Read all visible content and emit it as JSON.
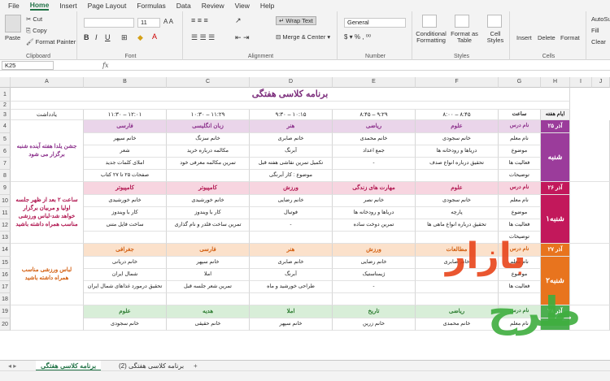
{
  "menu": [
    "File",
    "Home",
    "Insert",
    "Page Layout",
    "Formulas",
    "Data",
    "Review",
    "View",
    "Help"
  ],
  "ribbon": {
    "clipboard": {
      "paste": "Paste",
      "cut": "Cut",
      "copy": "Copy",
      "painter": "Format Painter",
      "label": "Clipboard"
    },
    "font": {
      "name": "",
      "size": "11",
      "label": "Font"
    },
    "alignment": {
      "wrap": "Wrap Text",
      "merge": "Merge & Center",
      "label": "Alignment"
    },
    "number": {
      "format": "General",
      "label": "Number"
    },
    "styles": {
      "cond": "Conditional Formatting",
      "table": "Format as Table",
      "cell": "Cell Styles",
      "label": "Styles"
    },
    "cells": {
      "insert": "Insert",
      "delete": "Delete",
      "format": "Format",
      "label": "Cells"
    },
    "editing": {
      "autosum": "AutoSu",
      "fill": "Fill",
      "clear": "Clear"
    }
  },
  "formula_bar": {
    "name_box": "K25",
    "fx": "fx",
    "value": ""
  },
  "columns": [
    "A",
    "B",
    "C",
    "D",
    "E",
    "F",
    "G",
    "H",
    "I",
    "J"
  ],
  "rows": [
    "1",
    "2",
    "3",
    "4",
    "5",
    "6",
    "7",
    "8",
    "9",
    "10",
    "11",
    "12",
    "13",
    "14",
    "15",
    "16",
    "17",
    "18",
    "19",
    "20"
  ],
  "sheet": {
    "title": "برنامه کلاسی هفتگی",
    "header": {
      "week": "ایام هفته",
      "time": "ساعت",
      "slots": [
        "۸:۰۰ – ۸:۴۵",
        "۸:۴۵ – ۹:۲۹",
        "۹:۳۰ – ۱۰:۱۵",
        "۱۰:۳۰ – ۱۱:۲۹",
        "۱۱:۳۰ – ۱۲:۰۱"
      ],
      "notes": "یادداشت"
    },
    "days": [
      {
        "name": "شنبه",
        "date": "۲۵ آذر",
        "color": "#9b3c9b",
        "light": "#ead5ea",
        "text": "#8b2f8b",
        "subjects": [
          "علوم",
          "ریاضی",
          "هنر",
          "زبان انگلیسی",
          "فارسی"
        ],
        "teachers": [
          "خانم سجودی",
          "خانم محمدی",
          "خانم صابری",
          "خانم سزنگ",
          "خانم سپهر"
        ],
        "topics": [
          "دریاها و رودخانه ها",
          "جمع اعداد",
          "آبرنگ",
          "مکالمه درباره خرید",
          "شعر"
        ],
        "activities": [
          "تحقیق درباره انواع صدف",
          "-",
          "تکمیل تمرین نقاشی هفته قبل",
          "تمرین مکالمه معرفی خود",
          "املای کلمات جدید"
        ],
        "desc": [
          "",
          "",
          "موضوع : کار آبرنگی",
          "",
          "صفحات ۲۵ تا ۲۷ کتاب"
        ],
        "note": "جشن یلدا هفته آینده شنبه برگزار می شود",
        "rows": [
          "نام درس",
          "نام معلم",
          "موضوع",
          "فعالیت ها",
          "توضیحات"
        ]
      },
      {
        "name": "۱شنبه",
        "date": "۲۶ آذر",
        "color": "#c2185b",
        "light": "#f7d5e0",
        "text": "#b0154f",
        "subjects": [
          "علوم",
          "مهارت های زندگی",
          "ورزش",
          "کامپیوتر",
          "کامپیوتر"
        ],
        "teachers": [
          "خانم سجودی",
          "خانم نصر",
          "خانم رضایی",
          "خانم خورشیدی",
          "خانم خورشیدی"
        ],
        "topics": [
          "پارچه",
          "دریاها و رودخانه ها",
          "فوتبال",
          "کار با ویندوز",
          "کار با ویندوز"
        ],
        "activities": [
          "تحقیق درباره انواع ماهی ها",
          "تمرین دوخت ساده",
          "-",
          "تمرین ساخت فلدر و نام گذاری",
          "ساخت فایل متنی"
        ],
        "desc": [
          "",
          "",
          "",
          "",
          ""
        ],
        "note": "ساعت ۲ بعد از ظهر جلسه اولیا و مربیان برگزار خواهد شد-لباس ورزشی مناسب همراه داشته باشید",
        "rows": [
          "نام درس",
          "نام معلم",
          "موضوع",
          "فعالیت ها",
          "توضیحات"
        ]
      },
      {
        "name": "۲شنبه",
        "date": "۲۷ آذر",
        "color": "#e8741e",
        "light": "#fbe1cb",
        "text": "#d35f10",
        "subjects": [
          "مطالعات",
          "ورزش",
          "هنر",
          "فارسی",
          "جغرافی"
        ],
        "teachers": [
          "خانم صابری",
          "خانم رضایی",
          "خانم صابری",
          "خانم سپهر",
          "خانم دریانی"
        ],
        "topics": [
          "",
          "ژیمناستیک",
          "آبرنگ",
          "املا",
          "شمال ایران"
        ],
        "activities": [
          "",
          "-",
          "طراحی خورشید و ماه",
          "تمرین شعر جلسه قبل",
          "تحقیق درمورد غذاهای شمال ایران"
        ],
        "desc": [
          "",
          "",
          "",
          "",
          ""
        ],
        "note": "لباس ورزشی مناسب همراه داشته باشید",
        "rows": [
          "نام درس",
          "نام معلم",
          "موضوع",
          "فعالیت ها",
          ""
        ]
      },
      {
        "name": "",
        "date": "۲۸ آذر",
        "color": "#4caf50",
        "light": "#d8eed8",
        "text": "#2e7d32",
        "subjects": [
          "ریاضی",
          "تاریخ",
          "املا",
          "هدیه",
          "علوم"
        ],
        "teachers": [
          "خانم محمدی",
          "خانم زرین",
          "خانم سپهر",
          "خانم حقیقی",
          "خانم سجودی"
        ],
        "topics": [],
        "activities": [],
        "desc": [],
        "note": "",
        "rows": [
          "نام درس",
          "نام معلم"
        ]
      }
    ]
  },
  "tabs": {
    "active": "برنامه کلاسی هفتگی",
    "other": "برنامه کلاسی هفتگی (2)",
    "add": "+"
  },
  "watermark": {
    "line1": "بازار",
    "line2": "طرح"
  }
}
